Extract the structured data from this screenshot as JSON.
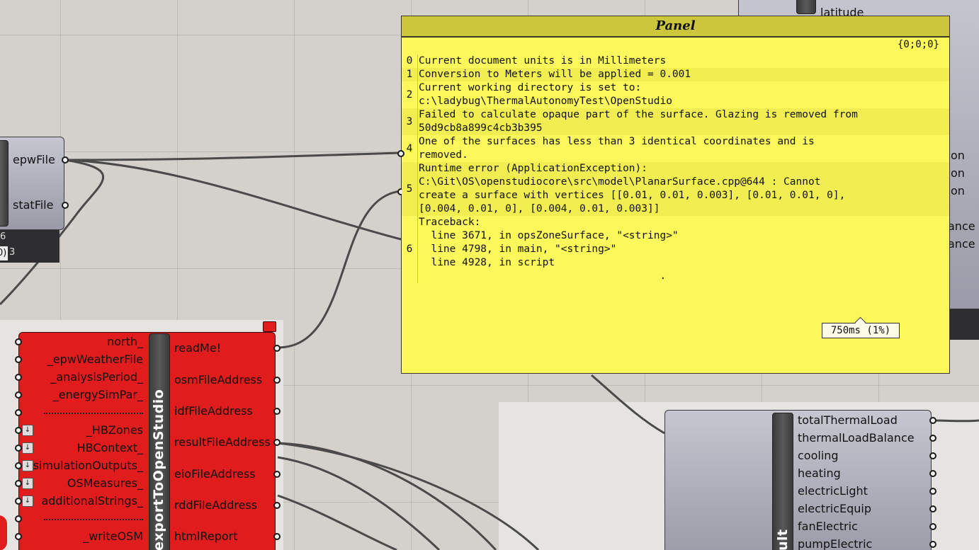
{
  "panel": {
    "title": "Panel",
    "path": "{0;0;0}",
    "lines": [
      {
        "index": "0",
        "text": "Current document units is in Millimeters"
      },
      {
        "index": "1",
        "text": "Conversion to Meters will be applied = 0.001"
      },
      {
        "index": "2",
        "text": "Current working directory is set to:\nc:\\ladybug\\ThermalAutonomyTest\\OpenStudio"
      },
      {
        "index": "3",
        "text": "Failed to calculate opaque part of the surface. Glazing is removed from\n50d9cb8a899c4cb3b395"
      },
      {
        "index": "4",
        "text": "One of the surfaces has less than 3 identical coordinates and is\nremoved."
      },
      {
        "index": "5",
        "text": "Runtime error (ApplicationException):\nC:\\Git\\OS\\openstudiocore\\src\\model\\PlanarSurface.cpp@644 : Cannot\ncreate a surface with vertices [[0.01, 0.01, 0.003], [0.01, 0.01, 0],\n[0.004, 0.01, 0], [0.004, 0.01, 0.003]]"
      },
      {
        "index": "6",
        "text": "Traceback:\n  line 3671, in opsZoneSurface, \"<string>\"\n  line 4798, in main, \"<string>\"\n  line 4928, in script\n                                       ."
      }
    ],
    "timer": "750ms (1%)"
  },
  "epw_component": {
    "outputs": [
      "epwFile",
      "statFile"
    ],
    "footer_a": "6",
    "footer_b": "0)",
    "footer_c": "3"
  },
  "export_component": {
    "title": "exportToOpenStudio",
    "inputs": [
      {
        "label": "north_",
        "arrow": false
      },
      {
        "label": "_epwWeatherFile",
        "arrow": false
      },
      {
        "label": "_analysisPeriod_",
        "arrow": false
      },
      {
        "label": "_energySimPar_",
        "arrow": false
      },
      {
        "label": "_HBZones",
        "arrow": true
      },
      {
        "label": "HBContext_",
        "arrow": true
      },
      {
        "label": "simulationOutputs_",
        "arrow": true
      },
      {
        "label": "OSMeasures_",
        "arrow": true
      },
      {
        "label": "additionalStrings_",
        "arrow": true
      },
      {
        "label": "_writeOSM",
        "arrow": false
      }
    ],
    "outputs": [
      "readMe!",
      "osmFileAddress",
      "idfFileAddress",
      "resultFileAddress",
      "eioFileAddress",
      "rddFileAddress",
      "htmlReport"
    ]
  },
  "result_component": {
    "title_fragment": "ult",
    "outputs": [
      "totalThermalLoad",
      "thermalLoadBalance",
      "cooling",
      "heating",
      "electricLight",
      "electricEquip",
      "fanElectric",
      "pumpElectric"
    ]
  },
  "top_right_component": {
    "label": "latitude",
    "partial_outputs": [
      "on",
      "on",
      "on",
      "ance",
      "ance"
    ]
  },
  "colors": {
    "panel_bg": "#fcf75a",
    "panel_header": "#cbc63a",
    "component_red": "#e01c1c",
    "component_grey": "#a8a8b4",
    "canvas": "#d4d1cc"
  }
}
